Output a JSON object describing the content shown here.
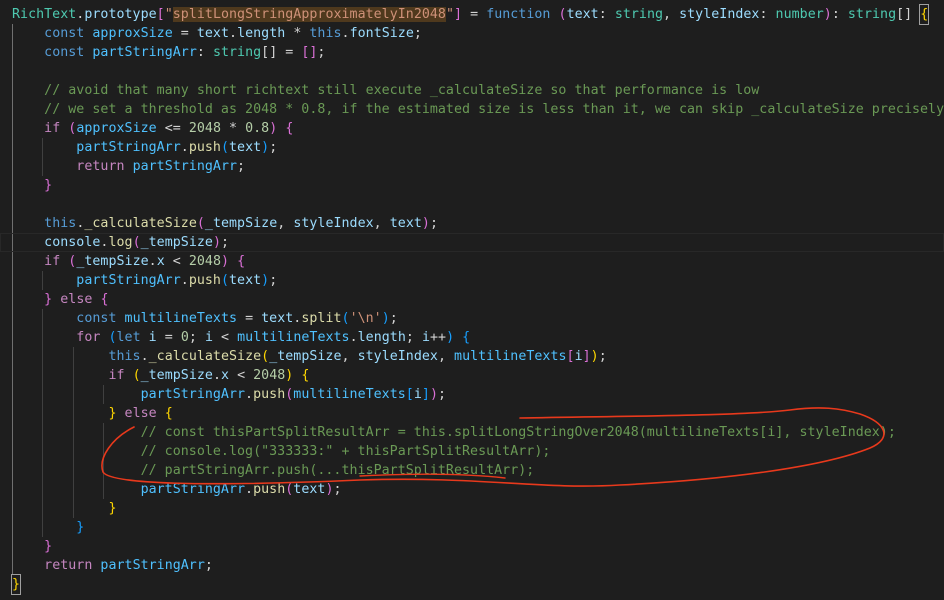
{
  "colors": {
    "background": "#1e1e1e",
    "keyword": "#569cd6",
    "control": "#c586c0",
    "variable": "#9cdcfe",
    "type": "#4ec9b0",
    "function": "#dcdcaa",
    "string": "#ce9178",
    "number": "#b5cea8",
    "comment": "#6a9955",
    "plain": "#d4d4d4",
    "bracket1": "#ffd700",
    "bracket2": "#da70d6",
    "bracket3": "#179fff",
    "annotation": "#e8391c"
  },
  "editor": {
    "lines": [
      [
        [
          "RichText",
          "type"
        ],
        [
          ".",
          "plain"
        ],
        [
          "prototype",
          "variable"
        ],
        [
          "[",
          "bracket2"
        ],
        [
          "\"",
          "string"
        ],
        [
          "splitLongStringApproximatelyIn2048",
          "string-hl"
        ],
        [
          "\"",
          "string"
        ],
        [
          "]",
          "bracket2"
        ],
        [
          " = ",
          "plain"
        ],
        [
          "function",
          "keyword"
        ],
        [
          " ",
          "plain"
        ],
        [
          "(",
          "bracket2"
        ],
        [
          "text",
          "variable"
        ],
        [
          ": ",
          "plain"
        ],
        [
          "string",
          "type"
        ],
        [
          ", ",
          "plain"
        ],
        [
          "styleIndex",
          "variable"
        ],
        [
          ": ",
          "plain"
        ],
        [
          "number",
          "type"
        ],
        [
          ")",
          "bracket2"
        ],
        [
          ": ",
          "plain"
        ],
        [
          "string",
          "type"
        ],
        [
          "[]",
          "plain"
        ],
        [
          " ",
          "plain"
        ],
        [
          "{",
          "bracket1-cursor"
        ]
      ],
      [
        [
          "    ",
          "plain"
        ],
        [
          "const",
          "keyword"
        ],
        [
          " ",
          "plain"
        ],
        [
          "approxSize",
          "const"
        ],
        [
          " = ",
          "plain"
        ],
        [
          "text",
          "variable"
        ],
        [
          ".",
          "plain"
        ],
        [
          "length",
          "variable"
        ],
        [
          " * ",
          "plain"
        ],
        [
          "this",
          "keyword"
        ],
        [
          ".",
          "plain"
        ],
        [
          "fontSize",
          "variable"
        ],
        [
          ";",
          "plain"
        ]
      ],
      [
        [
          "    ",
          "plain"
        ],
        [
          "const",
          "keyword"
        ],
        [
          " ",
          "plain"
        ],
        [
          "partStringArr",
          "const"
        ],
        [
          ": ",
          "plain"
        ],
        [
          "string",
          "type"
        ],
        [
          "[]",
          "plain"
        ],
        [
          " = ",
          "plain"
        ],
        [
          "[]",
          "bracket2"
        ],
        [
          ";",
          "plain"
        ]
      ],
      [],
      [
        [
          "    ",
          "plain"
        ],
        [
          "// avoid that many short richtext still execute _calculateSize so that performance is low",
          "comment"
        ]
      ],
      [
        [
          "    ",
          "plain"
        ],
        [
          "// we set a threshold as 2048 * 0.8, if the estimated size is less than it, we can skip _calculateSize precisely",
          "comment"
        ]
      ],
      [
        [
          "    ",
          "plain"
        ],
        [
          "if",
          "control"
        ],
        [
          " ",
          "plain"
        ],
        [
          "(",
          "bracket2"
        ],
        [
          "approxSize",
          "const"
        ],
        [
          " <= ",
          "plain"
        ],
        [
          "2048",
          "number"
        ],
        [
          " * ",
          "plain"
        ],
        [
          "0.8",
          "number"
        ],
        [
          ")",
          "bracket2"
        ],
        [
          " ",
          "plain"
        ],
        [
          "{",
          "bracket2"
        ]
      ],
      [
        [
          "        ",
          "plain"
        ],
        [
          "partStringArr",
          "const"
        ],
        [
          ".",
          "plain"
        ],
        [
          "push",
          "function"
        ],
        [
          "(",
          "bracket3"
        ],
        [
          "text",
          "variable"
        ],
        [
          ")",
          "bracket3"
        ],
        [
          ";",
          "plain"
        ]
      ],
      [
        [
          "        ",
          "plain"
        ],
        [
          "return",
          "control"
        ],
        [
          " ",
          "plain"
        ],
        [
          "partStringArr",
          "const"
        ],
        [
          ";",
          "plain"
        ]
      ],
      [
        [
          "    ",
          "plain"
        ],
        [
          "}",
          "bracket2"
        ]
      ],
      [],
      [
        [
          "    ",
          "plain"
        ],
        [
          "this",
          "keyword"
        ],
        [
          ".",
          "plain"
        ],
        [
          "_calculateSize",
          "function"
        ],
        [
          "(",
          "bracket2"
        ],
        [
          "_tempSize",
          "variable"
        ],
        [
          ", ",
          "plain"
        ],
        [
          "styleIndex",
          "variable"
        ],
        [
          ", ",
          "plain"
        ],
        [
          "text",
          "variable"
        ],
        [
          ")",
          "bracket2"
        ],
        [
          ";",
          "plain"
        ]
      ],
      [
        [
          "    ",
          "plain"
        ],
        [
          "console",
          "variable"
        ],
        [
          ".",
          "plain"
        ],
        [
          "log",
          "function"
        ],
        [
          "(",
          "bracket2"
        ],
        [
          "_tempSize",
          "variable"
        ],
        [
          ")",
          "bracket2"
        ],
        [
          ";",
          "plain"
        ]
      ],
      [
        [
          "    ",
          "plain"
        ],
        [
          "if",
          "control"
        ],
        [
          " ",
          "plain"
        ],
        [
          "(",
          "bracket2"
        ],
        [
          "_tempSize",
          "variable"
        ],
        [
          ".",
          "plain"
        ],
        [
          "x",
          "variable"
        ],
        [
          " < ",
          "plain"
        ],
        [
          "2048",
          "number"
        ],
        [
          ")",
          "bracket2"
        ],
        [
          " ",
          "plain"
        ],
        [
          "{",
          "bracket2"
        ]
      ],
      [
        [
          "        ",
          "plain"
        ],
        [
          "partStringArr",
          "const"
        ],
        [
          ".",
          "plain"
        ],
        [
          "push",
          "function"
        ],
        [
          "(",
          "bracket3"
        ],
        [
          "text",
          "variable"
        ],
        [
          ")",
          "bracket3"
        ],
        [
          ";",
          "plain"
        ]
      ],
      [
        [
          "    ",
          "plain"
        ],
        [
          "}",
          "bracket2"
        ],
        [
          " ",
          "plain"
        ],
        [
          "else",
          "control"
        ],
        [
          " ",
          "plain"
        ],
        [
          "{",
          "bracket2"
        ]
      ],
      [
        [
          "        ",
          "plain"
        ],
        [
          "const",
          "keyword"
        ],
        [
          " ",
          "plain"
        ],
        [
          "multilineTexts",
          "const"
        ],
        [
          " = ",
          "plain"
        ],
        [
          "text",
          "variable"
        ],
        [
          ".",
          "plain"
        ],
        [
          "split",
          "function"
        ],
        [
          "(",
          "bracket3"
        ],
        [
          "'\\n'",
          "string"
        ],
        [
          ")",
          "bracket3"
        ],
        [
          ";",
          "plain"
        ]
      ],
      [
        [
          "        ",
          "plain"
        ],
        [
          "for",
          "control"
        ],
        [
          " ",
          "plain"
        ],
        [
          "(",
          "bracket3"
        ],
        [
          "let",
          "keyword"
        ],
        [
          " ",
          "plain"
        ],
        [
          "i",
          "variable"
        ],
        [
          " = ",
          "plain"
        ],
        [
          "0",
          "number"
        ],
        [
          "; ",
          "plain"
        ],
        [
          "i",
          "variable"
        ],
        [
          " < ",
          "plain"
        ],
        [
          "multilineTexts",
          "const"
        ],
        [
          ".",
          "plain"
        ],
        [
          "length",
          "variable"
        ],
        [
          "; ",
          "plain"
        ],
        [
          "i",
          "variable"
        ],
        [
          "++",
          "plain"
        ],
        [
          ")",
          "bracket3"
        ],
        [
          " ",
          "plain"
        ],
        [
          "{",
          "bracket3"
        ]
      ],
      [
        [
          "            ",
          "plain"
        ],
        [
          "this",
          "keyword"
        ],
        [
          ".",
          "plain"
        ],
        [
          "_calculateSize",
          "function"
        ],
        [
          "(",
          "bracket1"
        ],
        [
          "_tempSize",
          "variable"
        ],
        [
          ", ",
          "plain"
        ],
        [
          "styleIndex",
          "variable"
        ],
        [
          ", ",
          "plain"
        ],
        [
          "multilineTexts",
          "const"
        ],
        [
          "[",
          "bracket2"
        ],
        [
          "i",
          "variable"
        ],
        [
          "]",
          "bracket2"
        ],
        [
          ")",
          "bracket1"
        ],
        [
          ";",
          "plain"
        ]
      ],
      [
        [
          "            ",
          "plain"
        ],
        [
          "if",
          "control"
        ],
        [
          " ",
          "plain"
        ],
        [
          "(",
          "bracket1"
        ],
        [
          "_tempSize",
          "variable"
        ],
        [
          ".",
          "plain"
        ],
        [
          "x",
          "variable"
        ],
        [
          " < ",
          "plain"
        ],
        [
          "2048",
          "number"
        ],
        [
          ")",
          "bracket1"
        ],
        [
          " ",
          "plain"
        ],
        [
          "{",
          "bracket1"
        ]
      ],
      [
        [
          "                ",
          "plain"
        ],
        [
          "partStringArr",
          "const"
        ],
        [
          ".",
          "plain"
        ],
        [
          "push",
          "function"
        ],
        [
          "(",
          "bracket2"
        ],
        [
          "multilineTexts",
          "const"
        ],
        [
          "[",
          "bracket3"
        ],
        [
          "i",
          "variable"
        ],
        [
          "]",
          "bracket3"
        ],
        [
          ")",
          "bracket2"
        ],
        [
          ";",
          "plain"
        ]
      ],
      [
        [
          "            ",
          "plain"
        ],
        [
          "}",
          "bracket1"
        ],
        [
          " ",
          "plain"
        ],
        [
          "else",
          "control"
        ],
        [
          " ",
          "plain"
        ],
        [
          "{",
          "bracket1"
        ]
      ],
      [
        [
          "                ",
          "plain"
        ],
        [
          "// const thisPartSplitResultArr = this.splitLongStringOver2048(multilineTexts[i], styleIndex);",
          "comment"
        ]
      ],
      [
        [
          "                ",
          "plain"
        ],
        [
          "// console.log(\"333333:\" + thisPartSplitResultArr);",
          "comment"
        ]
      ],
      [
        [
          "                ",
          "plain"
        ],
        [
          "// partStringArr.push(...thisPartSplitResultArr);",
          "comment"
        ]
      ],
      [
        [
          "                ",
          "plain"
        ],
        [
          "partStringArr",
          "const"
        ],
        [
          ".",
          "plain"
        ],
        [
          "push",
          "function"
        ],
        [
          "(",
          "bracket2"
        ],
        [
          "text",
          "variable"
        ],
        [
          ")",
          "bracket2"
        ],
        [
          ";",
          "plain"
        ]
      ],
      [
        [
          "            ",
          "plain"
        ],
        [
          "}",
          "bracket1"
        ]
      ],
      [
        [
          "        ",
          "plain"
        ],
        [
          "}",
          "bracket3"
        ]
      ],
      [
        [
          "    ",
          "plain"
        ],
        [
          "}",
          "bracket2"
        ]
      ],
      [
        [
          "    ",
          "plain"
        ],
        [
          "return",
          "control"
        ],
        [
          " ",
          "plain"
        ],
        [
          "partStringArr",
          "const"
        ],
        [
          ";",
          "plain"
        ]
      ],
      [
        [
          "}",
          "bracket1-cursor"
        ]
      ]
    ]
  }
}
